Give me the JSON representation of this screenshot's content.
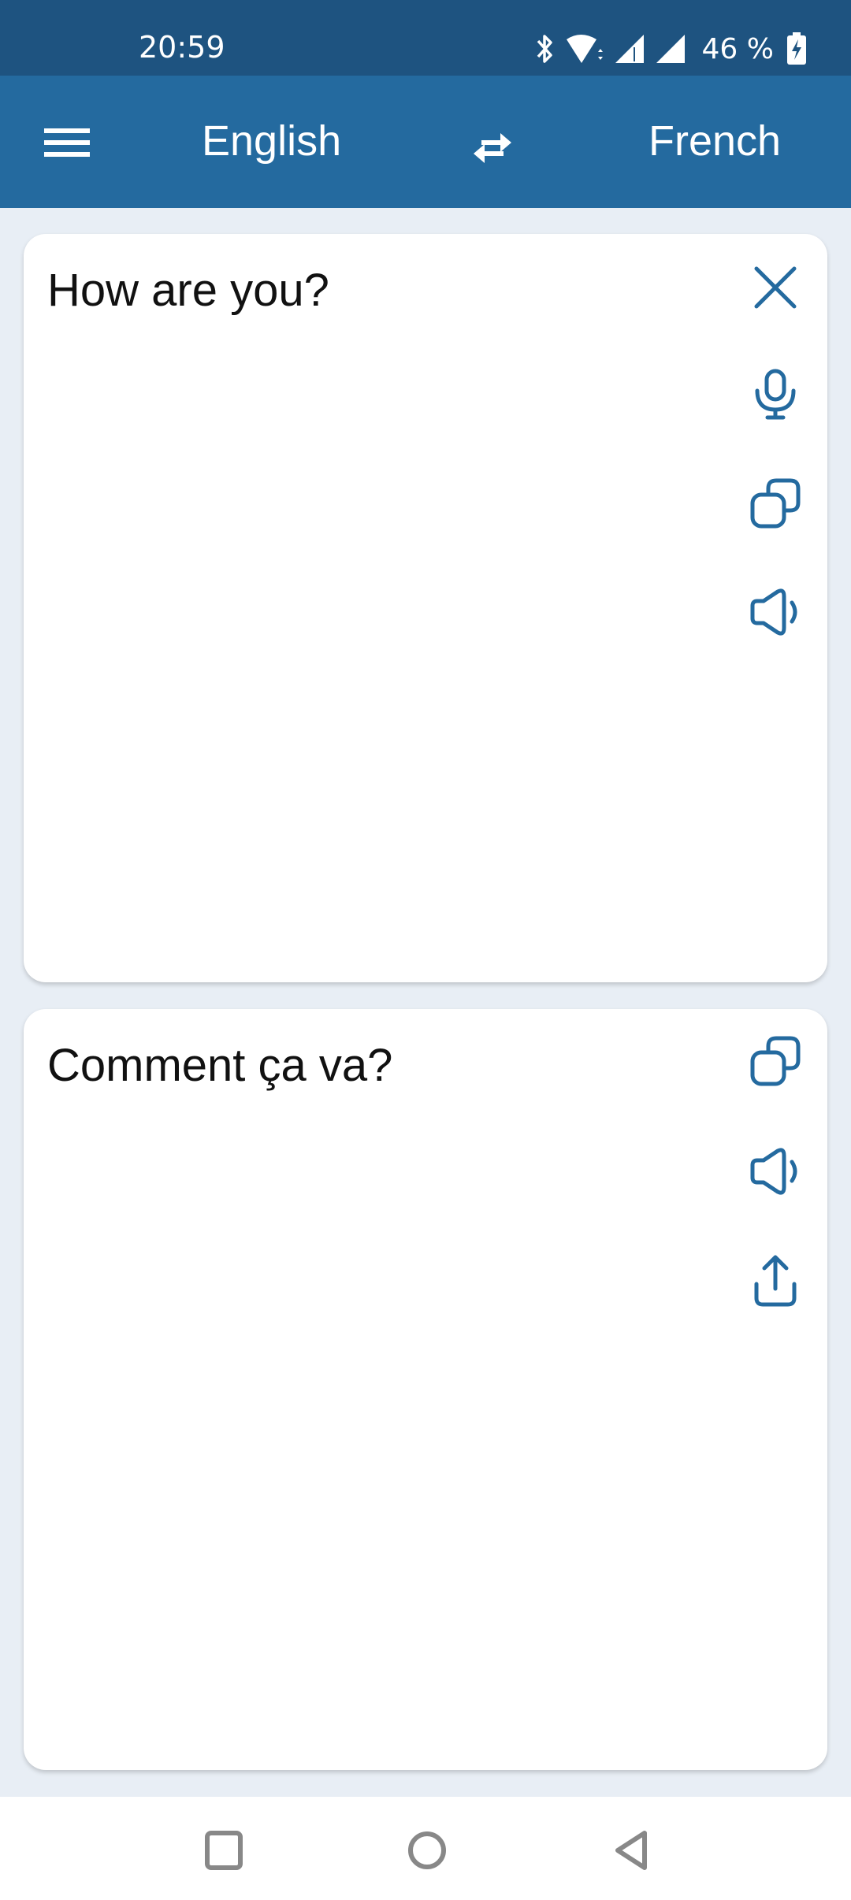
{
  "status_bar": {
    "time": "20:59",
    "battery_percent": "46 %",
    "icons": [
      "bluetooth-icon",
      "wifi-icon",
      "signal-icon",
      "signal-icon",
      "battery-charging-icon"
    ]
  },
  "app_bar": {
    "menu_icon": "hamburger-menu-icon",
    "source_language": "English",
    "swap_icon": "swap-arrows-icon",
    "target_language": "French"
  },
  "source_card": {
    "text": "How are you?",
    "actions": [
      "clear-icon",
      "microphone-icon",
      "copy-icon",
      "speaker-icon"
    ]
  },
  "target_card": {
    "text": "Comment ça va?",
    "actions": [
      "copy-icon",
      "speaker-icon",
      "share-icon"
    ]
  },
  "nav_bar": {
    "buttons": [
      "recents-icon",
      "home-icon",
      "back-icon"
    ]
  },
  "colors": {
    "status_bar": "#1e5380",
    "app_bar": "#246a9f",
    "accent_icon": "#246a9f",
    "background": "#e8eef5"
  }
}
